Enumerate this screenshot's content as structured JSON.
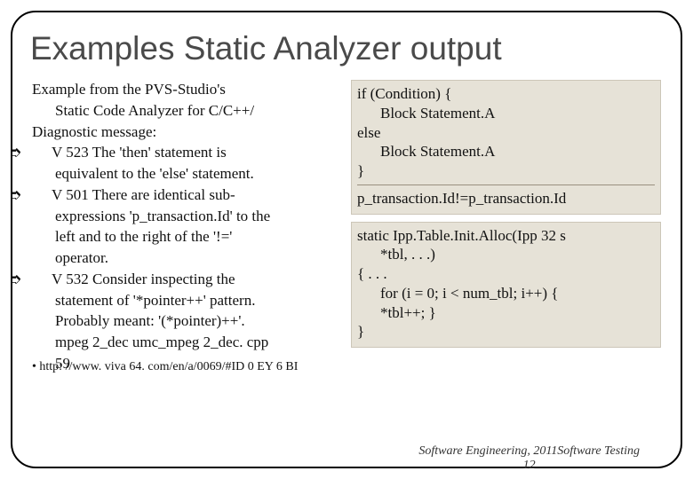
{
  "title": "Examples Static Analyzer output",
  "left": {
    "intro_l1": "Example from the PVS-Studio's",
    "intro_l2": "Static Code Analyzer for C/C++/",
    "diag_label": "Diagnostic message:",
    "b1_l1": "V 523 The 'then' statement is",
    "b1_l2": "equivalent to the 'else' statement.",
    "b2_l1": "V 501 There are identical sub-",
    "b2_l2": "expressions 'p_transaction.Id' to the",
    "b2_l3": "left and to the right of the '!='",
    "b2_l4": "operator.",
    "b3_l1": "V 532 Consider inspecting the",
    "b3_l2": "statement of '*pointer++' pattern.",
    "b3_l3": "Probably meant: '(*pointer)++'.",
    "b3_l4": "mpeg 2_dec umc_mpeg 2_dec. cpp",
    "b3_l5": "59",
    "ref": "• http: //www. viva 64. com/en/a/0069/#ID 0 EY 6 BI"
  },
  "right": {
    "box1": {
      "l1": "if  (Condition) {",
      "l2": "Block Statement.A",
      "l3": "else",
      "l4": "Block Statement.A",
      "l5": "}",
      "l6": "p_transaction.Id!=p_transaction.Id"
    },
    "box2": {
      "l1": "static Ipp.Table.Init.Alloc(Ipp 32 s",
      "l2": "*tbl, . . .)",
      "l3": "{ . . .",
      "l4": "for (i = 0; i < num_tbl; i++) {",
      "l5": "*tbl++; }",
      "l6": "}"
    }
  },
  "footer": {
    "line1": "Software Engineering,  2011Software  Testing",
    "line2": "12"
  },
  "bullet": "➮"
}
